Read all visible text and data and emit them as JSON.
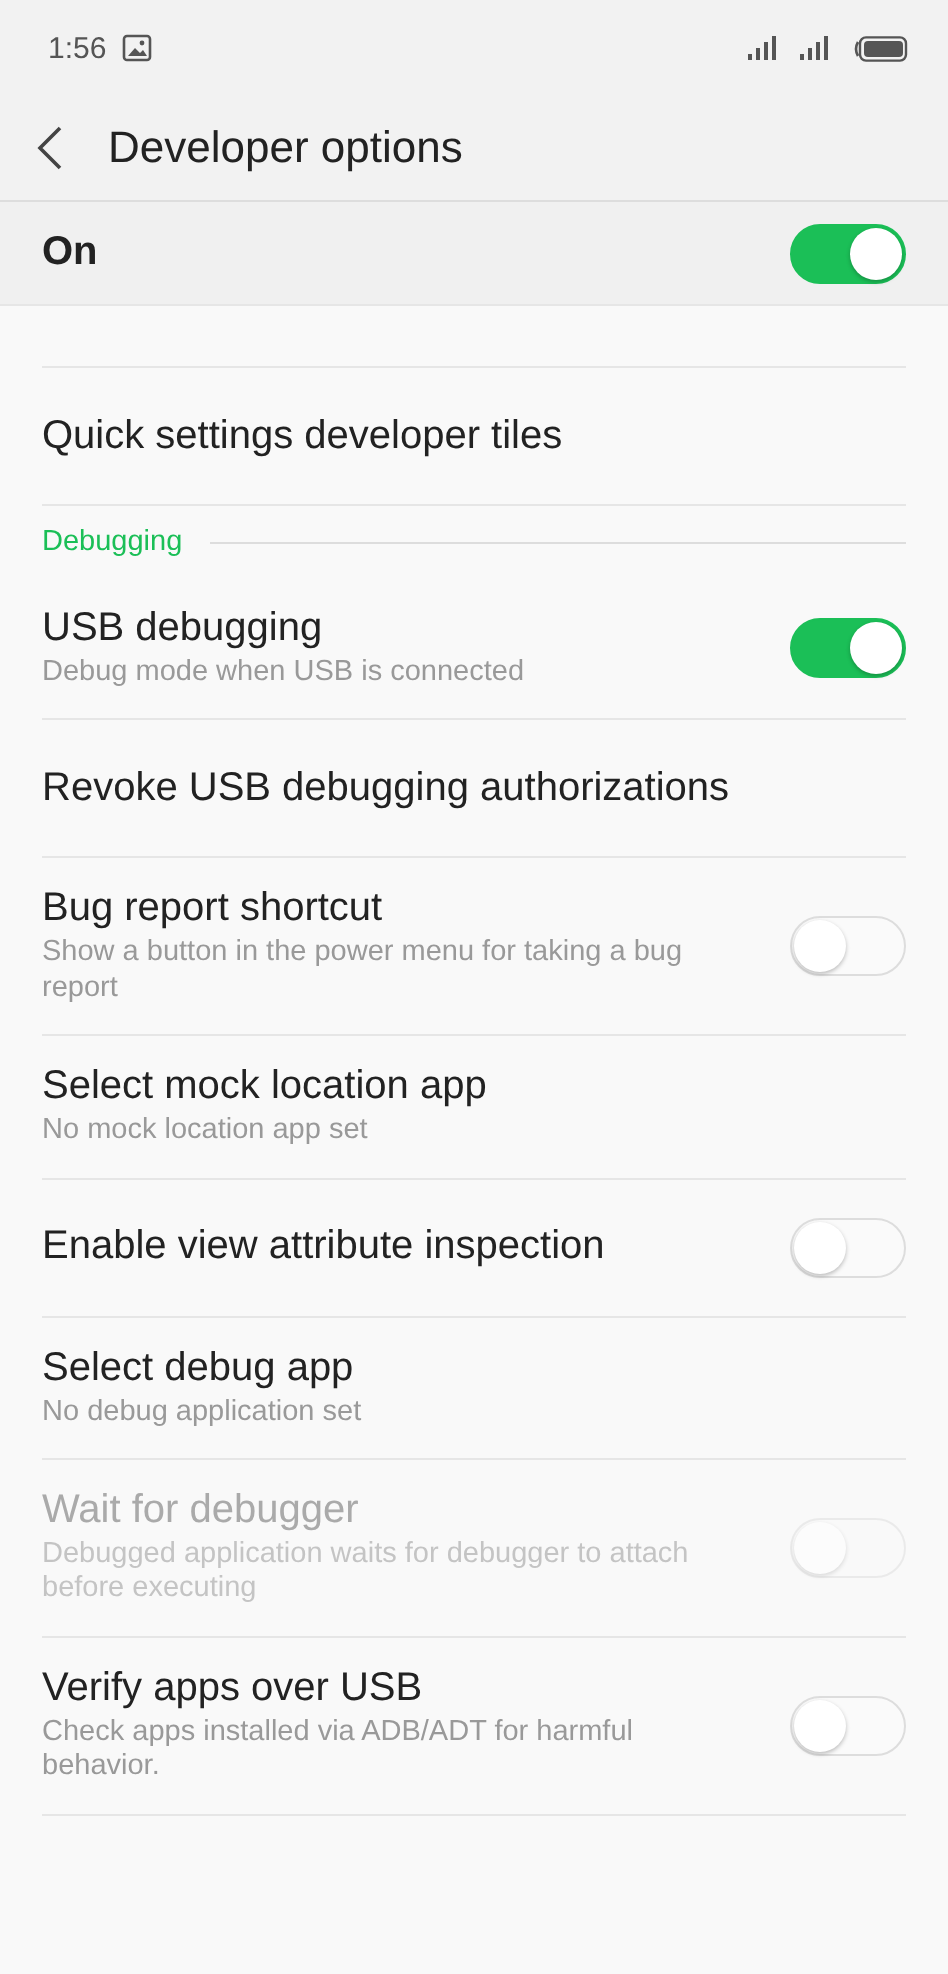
{
  "status_bar": {
    "time": "1:56"
  },
  "header": {
    "title": "Developer options"
  },
  "master_switch": {
    "label": "On",
    "on": true
  },
  "items": [
    {
      "kind": "plain",
      "title": "Quick settings developer tiles",
      "disabled": false
    },
    {
      "kind": "section",
      "title": "Debugging"
    },
    {
      "kind": "toggle",
      "title": "USB debugging",
      "subtitle": "Debug mode when USB is connected",
      "on": true,
      "disabled": false
    },
    {
      "kind": "plain",
      "title": "Revoke USB debugging authorizations",
      "disabled": false
    },
    {
      "kind": "toggle",
      "title": "Bug report shortcut",
      "subtitle": "Show a button in the power menu for taking a bug report",
      "on": false,
      "disabled": false
    },
    {
      "kind": "plain",
      "title": "Select mock location app",
      "subtitle": "No mock location app set",
      "disabled": false
    },
    {
      "kind": "toggle",
      "title": "Enable view attribute inspection",
      "on": false,
      "disabled": false
    },
    {
      "kind": "plain",
      "title": "Select debug app",
      "subtitle": "No debug application set",
      "disabled": false
    },
    {
      "kind": "toggle",
      "title": "Wait for debugger",
      "subtitle": "Debugged application waits for debugger to attach before executing",
      "on": false,
      "disabled": true
    },
    {
      "kind": "toggle",
      "title": "Verify apps over USB",
      "subtitle": "Check apps installed via ADB/ADT for harmful behavior.",
      "on": false,
      "disabled": false
    }
  ]
}
